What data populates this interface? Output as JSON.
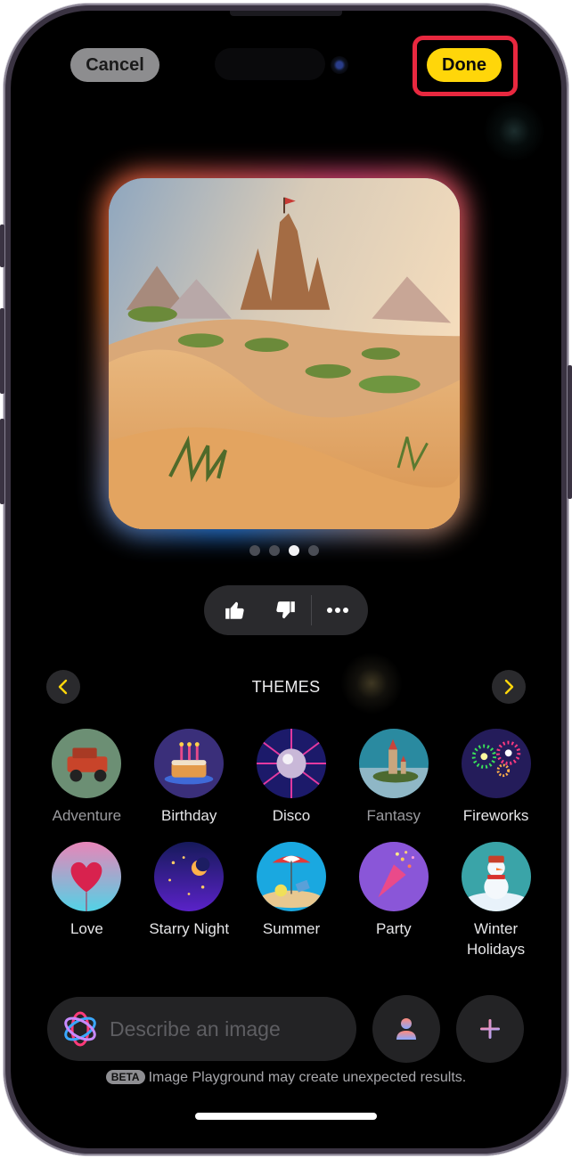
{
  "header": {
    "cancel_label": "Cancel",
    "done_label": "Done",
    "highlight_color": "#e8283f",
    "accent_color": "#ffd60a"
  },
  "preview": {
    "description": "Generated image: desert dunes with acacia trees and a sand castle on a hill",
    "page_count": 4,
    "current_page": 3
  },
  "feedback": {
    "thumbs_up": "thumbs-up-icon",
    "thumbs_down": "thumbs-down-icon",
    "more": "ellipsis-icon"
  },
  "themes": {
    "title": "THEMES",
    "prev_icon": "chevron-left-icon",
    "next_icon": "chevron-right-icon",
    "items": [
      {
        "label": "Adventure",
        "selected": false
      },
      {
        "label": "Birthday",
        "selected": false
      },
      {
        "label": "Disco",
        "selected": false
      },
      {
        "label": "Fantasy",
        "selected": false
      },
      {
        "label": "Fireworks",
        "selected": false
      },
      {
        "label": "Love",
        "selected": false
      },
      {
        "label": "Starry Night",
        "selected": false
      },
      {
        "label": "Summer",
        "selected": false
      },
      {
        "label": "Party",
        "selected": false
      },
      {
        "label": "Winter Holidays",
        "selected": false
      }
    ]
  },
  "prompt": {
    "placeholder": "Describe an image",
    "value": "",
    "person_button": "person-icon",
    "add_button": "plus-icon"
  },
  "footer": {
    "beta_badge": "BETA",
    "disclaimer": "Image Playground may create unexpected results."
  }
}
